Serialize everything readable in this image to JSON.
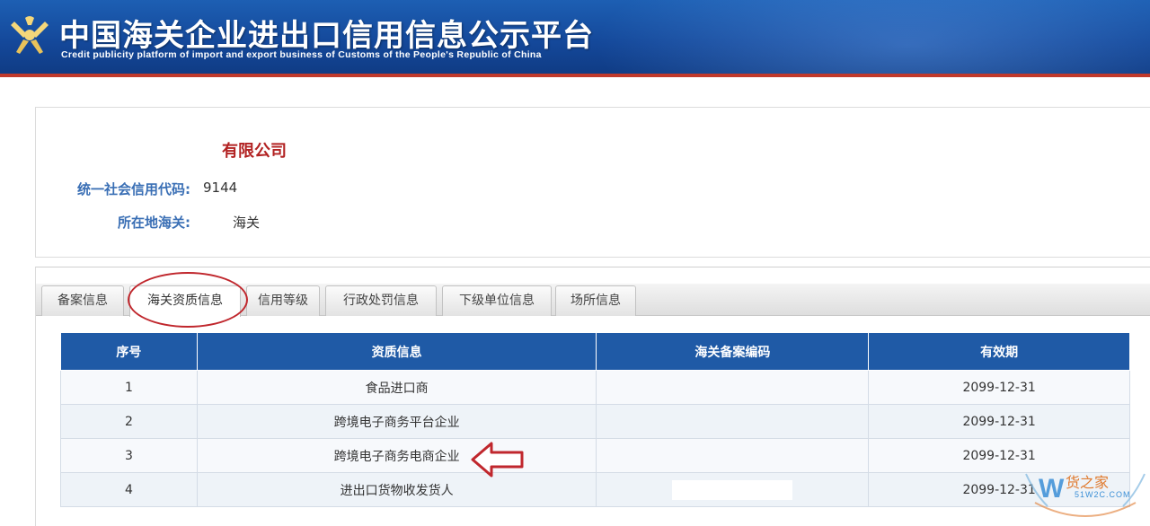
{
  "header": {
    "title_cn": "中国海关企业进出口信用信息公示平台",
    "title_en": "Credit publicity platform of import and export business of Customs of the People's Republic of China",
    "logo_icon": "customs-emblem-icon"
  },
  "company": {
    "name": "有限公司",
    "credit_code_label": "统一社会信用代码:",
    "credit_code_value": "9144",
    "customs_label": "所在地海关:",
    "customs_value": "海关"
  },
  "tabs": [
    {
      "label": "备案信息",
      "active": false
    },
    {
      "label": "海关资质信息",
      "active": true
    },
    {
      "label": "信用等级",
      "active": false
    },
    {
      "label": "行政处罚信息",
      "active": false
    },
    {
      "label": "下级单位信息",
      "active": false
    },
    {
      "label": "场所信息",
      "active": false
    }
  ],
  "table": {
    "headers": [
      "序号",
      "资质信息",
      "海关备案编码",
      "有效期"
    ],
    "rows": [
      {
        "index": "1",
        "qualification": "食品进口商",
        "code": "",
        "validity": "2099-12-31"
      },
      {
        "index": "2",
        "qualification": "跨境电子商务平台企业",
        "code": "",
        "validity": "2099-12-31"
      },
      {
        "index": "3",
        "qualification": "跨境电子商务电商企业",
        "code": "",
        "validity": "2099-12-31"
      },
      {
        "index": "4",
        "qualification": "进出口货物收发货人",
        "code": "",
        "validity": "2099-12-31"
      }
    ]
  },
  "watermark": {
    "brand": "货之家",
    "domain": "51W2C.COM"
  },
  "colors": {
    "header_blue": "#14489a",
    "accent_red": "#c0392b",
    "company_red": "#b22222",
    "label_blue": "#3a6fb5",
    "table_header": "#1f5aa6",
    "watermark_orange": "#e07a2e"
  }
}
